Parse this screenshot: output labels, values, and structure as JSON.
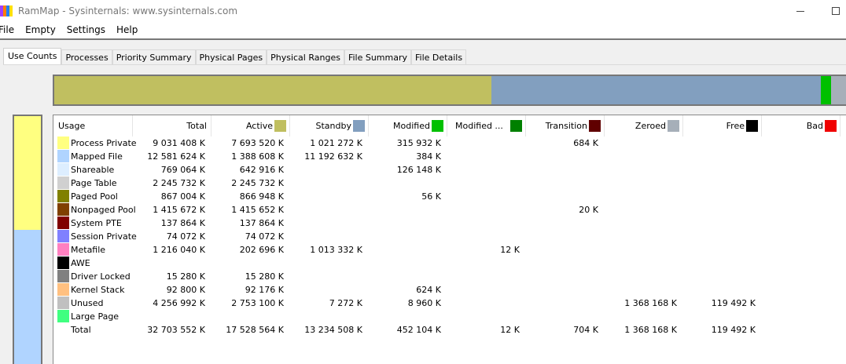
{
  "window": {
    "title": "RamMap - Sysinternals: www.sysinternals.com"
  },
  "menu": [
    "File",
    "Empty",
    "Settings",
    "Help"
  ],
  "tabs": [
    "Use Counts",
    "Processes",
    "Priority Summary",
    "Physical Pages",
    "Physical Ranges",
    "File Summary",
    "File Details"
  ],
  "colors": {
    "active": "#c0bf60",
    "standby": "#829fbf",
    "modified": "#00c000",
    "modified_nowrite": "#008000",
    "transition": "#600000",
    "zeroed": "#a6afb9",
    "free": "#000000",
    "bad": "#f00000"
  },
  "columns": [
    {
      "label": "Usage",
      "swatch": null
    },
    {
      "label": "Total",
      "swatch": null
    },
    {
      "label": "Active",
      "swatch": "#c0bf60"
    },
    {
      "label": "Standby",
      "swatch": "#829fbf"
    },
    {
      "label": "Modified",
      "swatch": "#00c000"
    },
    {
      "label": "Modified ...",
      "swatch": "#008000"
    },
    {
      "label": "Transition",
      "swatch": "#600000"
    },
    {
      "label": "Zeroed",
      "swatch": "#a6afb9"
    },
    {
      "label": "Free",
      "swatch": "#000000"
    },
    {
      "label": "Bad",
      "swatch": "#f00000"
    }
  ],
  "rows": [
    {
      "usage": "Process Private",
      "color": "#ffff80",
      "values": [
        "9 031 408 K",
        "7 693 520 K",
        "1 021 272 K",
        "315 932 K",
        "",
        "684 K",
        "",
        "",
        ""
      ]
    },
    {
      "usage": "Mapped File",
      "color": "#b0d4ff",
      "values": [
        "12 581 624 K",
        "1 388 608 K",
        "11 192 632 K",
        "384 K",
        "",
        "",
        "",
        "",
        ""
      ]
    },
    {
      "usage": "Shareable",
      "color": "#ddeeff",
      "values": [
        "769 064 K",
        "642 916 K",
        "",
        "126 148 K",
        "",
        "",
        "",
        "",
        ""
      ]
    },
    {
      "usage": "Page Table",
      "color": "#d0d0d0",
      "values": [
        "2 245 732 K",
        "2 245 732 K",
        "",
        "",
        "",
        "",
        "",
        "",
        ""
      ]
    },
    {
      "usage": "Paged Pool",
      "color": "#808000",
      "values": [
        "867 004 K",
        "866 948 K",
        "",
        "56 K",
        "",
        "",
        "",
        "",
        ""
      ]
    },
    {
      "usage": "Nonpaged Pool",
      "color": "#804000",
      "values": [
        "1 415 672 K",
        "1 415 652 K",
        "",
        "",
        "",
        "20 K",
        "",
        "",
        ""
      ]
    },
    {
      "usage": "System PTE",
      "color": "#800000",
      "values": [
        "137 864 K",
        "137 864 K",
        "",
        "",
        "",
        "",
        "",
        "",
        ""
      ]
    },
    {
      "usage": "Session Private",
      "color": "#8080ff",
      "values": [
        "74 072 K",
        "74 072 K",
        "",
        "",
        "",
        "",
        "",
        "",
        ""
      ]
    },
    {
      "usage": "Metafile",
      "color": "#ff80c0",
      "values": [
        "1 216 040 K",
        "202 696 K",
        "1 013 332 K",
        "",
        "12 K",
        "",
        "",
        "",
        ""
      ]
    },
    {
      "usage": "AWE",
      "color": "#000000",
      "values": [
        "",
        "",
        "",
        "",
        "",
        "",
        "",
        "",
        ""
      ]
    },
    {
      "usage": "Driver Locked",
      "color": "#808080",
      "values": [
        "15 280 K",
        "15 280 K",
        "",
        "",
        "",
        "",
        "",
        "",
        ""
      ]
    },
    {
      "usage": "Kernel Stack",
      "color": "#ffc080",
      "values": [
        "92 800 K",
        "92 176 K",
        "",
        "624 K",
        "",
        "",
        "",
        "",
        ""
      ]
    },
    {
      "usage": "Unused",
      "color": "#c0c0c0",
      "values": [
        "4 256 992 K",
        "2 753 100 K",
        "7 272 K",
        "8 960 K",
        "",
        "",
        "1 368 168 K",
        "119 492 K",
        ""
      ]
    },
    {
      "usage": "Large Page",
      "color": "#40ff80",
      "values": [
        "",
        "",
        "",
        "",
        "",
        "",
        "",
        "",
        ""
      ]
    },
    {
      "usage": "Total",
      "color": null,
      "values": [
        "32 703 552 K",
        "17 528 564 K",
        "13 234 508 K",
        "452 104 K",
        "12 K",
        "704 K",
        "1 368 168 K",
        "119 492 K",
        ""
      ]
    }
  ],
  "memory_bar": [
    {
      "name": "active",
      "color": "#c0bf60",
      "fraction": 0.552
    },
    {
      "name": "standby",
      "color": "#829fbf",
      "fraction": 0.416
    },
    {
      "name": "modified",
      "color": "#00c000",
      "fraction": 0.013
    },
    {
      "name": "zeroed",
      "color": "#a6afb9",
      "fraction": 0.019
    }
  ],
  "usage_bar": [
    {
      "name": "process-private",
      "color": "#ffff80",
      "fraction": 0.46
    },
    {
      "name": "mapped-file",
      "color": "#b0d4ff",
      "fraction": 0.54
    }
  ]
}
